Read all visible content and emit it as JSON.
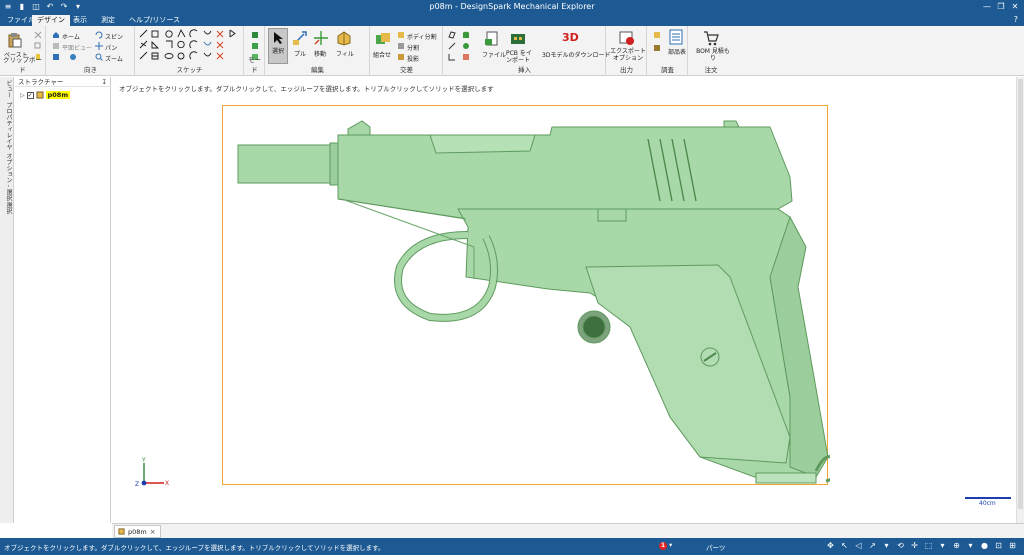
{
  "window": {
    "title": "p08m - DesignSpark Mechanical Explorer",
    "minimize": "—",
    "restore": "❐",
    "close": "✕"
  },
  "quick_access": [
    "≡",
    "▮",
    "◫",
    "↶",
    "↷",
    "▾"
  ],
  "menu": {
    "tabs": [
      {
        "label": "ファイル",
        "active": false
      },
      {
        "label": "デザイン",
        "active": true
      },
      {
        "label": "表示",
        "active": false
      },
      {
        "label": "測定",
        "active": false
      },
      {
        "label": "ヘルプ/リソース",
        "active": false
      }
    ],
    "help": "?"
  },
  "ribbon": {
    "groups": {
      "clipboard": {
        "title": "クリップボード",
        "paste": "ペースト"
      },
      "orient": {
        "title": "向き",
        "home": "ホーム",
        "plane_view": "平面ビュー",
        "spin": "スピン",
        "pan": "パン",
        "zoom": "ズーム"
      },
      "sketch": {
        "title": "スケッチ"
      },
      "mode": {
        "title": "モード"
      },
      "edit": {
        "title": "編集",
        "select": "選択",
        "pull": "プル",
        "move": "移動",
        "fill": "フィル"
      },
      "intersect": {
        "title": "交差",
        "combine": "組合せ",
        "split_body": "ボディ分割",
        "split": "分割",
        "project": "投影"
      },
      "insert": {
        "title": "挿入",
        "file": "ファイル",
        "pcb": "PCB をインポート",
        "download_3d": "3Dモデルのダウンロード",
        "logo_3d": "3D"
      },
      "output": {
        "title": "出力",
        "export": "エクスポートオプション"
      },
      "investigate": {
        "title": "調査",
        "parts": "部品表"
      },
      "order": {
        "title": "注文",
        "bom": "BOM 見積もり"
      }
    }
  },
  "side_tabs": [
    "ビュー",
    "プロパティ",
    "レイヤ",
    "オプション - 選択",
    "選択"
  ],
  "structure": {
    "title": "ストラクチャー",
    "pin": "↧",
    "root": {
      "expander": "▷",
      "checkbox": "✓",
      "name": "p08m"
    }
  },
  "canvas": {
    "hint": "オブジェクトをクリックします。ダブルクリックして、エッジループを選択します。トリプルクリックしてソリッドを選択します",
    "axes": {
      "y": "Y",
      "z": "Z",
      "x": "X"
    },
    "scale": "40cm"
  },
  "doc_tab": {
    "name": "p08m",
    "close": "×"
  },
  "status": {
    "message": "オブジェクトをクリックします。ダブルクリックして、エッジループを選択します。トリプルクリックしてソリッドを選択します。",
    "error_count": "1",
    "error_dropdown": "▾",
    "selection": "パーツ",
    "tools": [
      "✥",
      "↖",
      "◁",
      "↗",
      "▾",
      "⟲",
      "✛",
      "⬚",
      "▾",
      "⊕",
      "▾",
      "●",
      "⊡",
      "⊞"
    ]
  },
  "colors": {
    "accent": "#1d5a93",
    "model_fill": "#a8d8a8",
    "model_edge": "#5e9a5e",
    "frame": "#f0a431",
    "highlight": "#ffff00"
  }
}
